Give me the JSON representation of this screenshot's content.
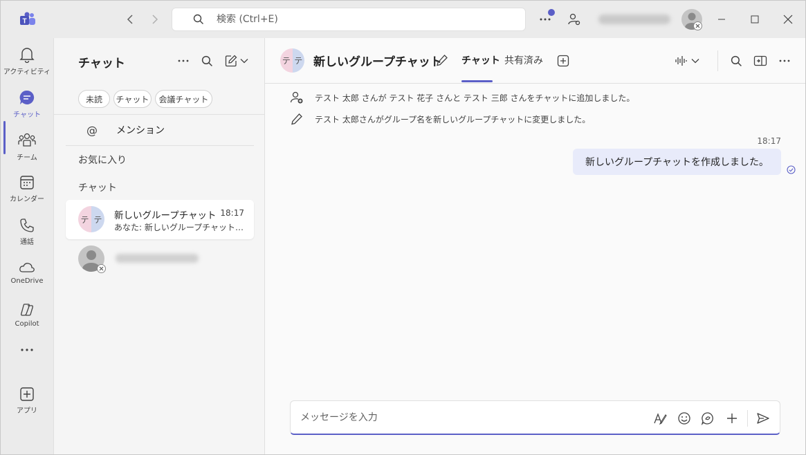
{
  "search": {
    "placeholder": "検索 (Ctrl+E)"
  },
  "rail": {
    "items": [
      {
        "label": "アクティビティ"
      },
      {
        "label": "チャット"
      },
      {
        "label": "チーム"
      },
      {
        "label": "カレンダー"
      },
      {
        "label": "通話"
      },
      {
        "label": "OneDrive"
      },
      {
        "label": "Copilot"
      },
      {
        "label": "アプリ"
      }
    ]
  },
  "list": {
    "title": "チャット",
    "filters": [
      "未読",
      "チャット",
      "会議チャット"
    ],
    "mention_label": "メンション",
    "mention_symbol": "@",
    "favorites_label": "お気に入り",
    "chats_label": "チャット",
    "chats": [
      {
        "avatar_left": "テ",
        "avatar_right": "テ",
        "name": "新しいグループチャット",
        "time": "18:17",
        "preview": "あなた: 新しいグループチャットを作..."
      }
    ]
  },
  "main": {
    "avatar_left": "テ",
    "avatar_right": "テ",
    "title": "新しいグループチャット",
    "tabs": [
      {
        "label": "チャット"
      },
      {
        "label": "共有済み"
      }
    ],
    "system_messages": [
      "テスト 太郎 さんが テスト 花子 さんと テスト 三郎 さんをチャットに追加しました。",
      "テスト 太郎さんがグループ名を新しいグループチャットに変更しました。"
    ],
    "message": {
      "time": "18:17",
      "text": "新しいグループチャットを作成しました。"
    },
    "composer_placeholder": "メッセージを入力"
  },
  "colors": {
    "accent": "#5b5fc7",
    "bubble": "#e8ebfa",
    "avatar_left": "#f3d4e0",
    "avatar_right": "#cdd8ef"
  }
}
